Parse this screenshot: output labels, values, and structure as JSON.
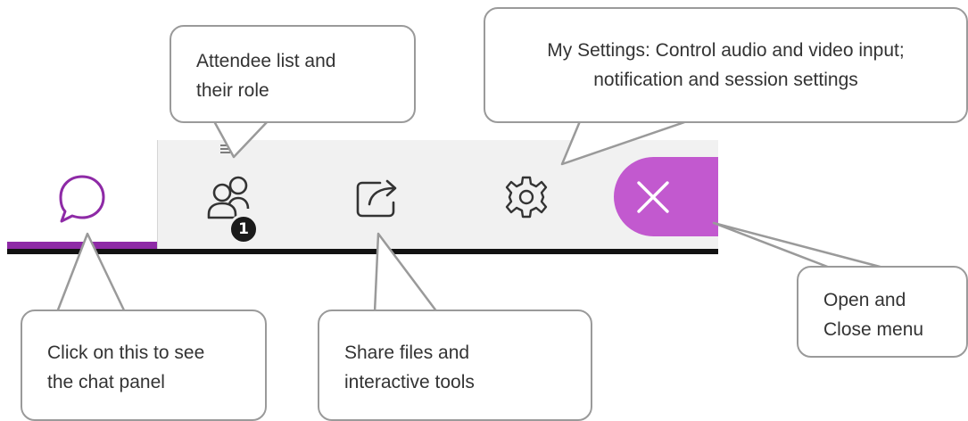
{
  "toolbar": {
    "accent_color": "#8e2aa6",
    "close_color": "#c259cf",
    "attendee_badge": "1",
    "items": [
      {
        "id": "chat",
        "icon": "chat-bubble-icon",
        "active": true
      },
      {
        "id": "attendees",
        "icon": "people-icon"
      },
      {
        "id": "share",
        "icon": "share-icon"
      },
      {
        "id": "settings",
        "icon": "gear-icon"
      },
      {
        "id": "close",
        "icon": "close-icon"
      }
    ]
  },
  "callouts": {
    "attendees": [
      "Attendee list and",
      "their role"
    ],
    "settings": [
      "My Settings: Control audio and video input;",
      "notification and session settings"
    ],
    "chat": [
      "Click on this to see",
      "the chat panel"
    ],
    "share": [
      "Share files and",
      "interactive tools"
    ],
    "close": [
      "Open and",
      "Close menu"
    ]
  }
}
